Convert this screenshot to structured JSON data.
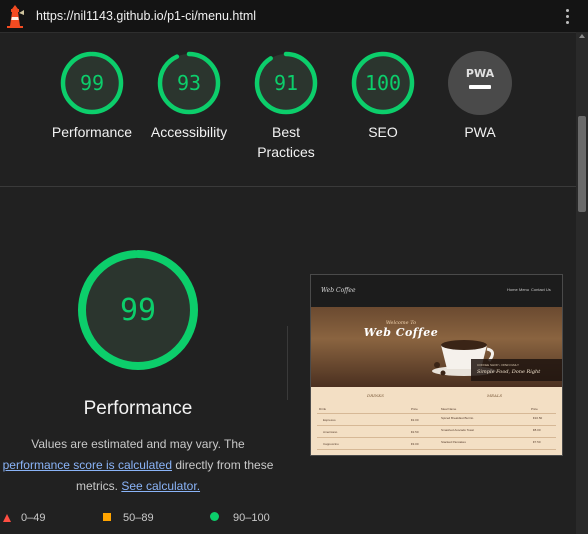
{
  "browser": {
    "url": "https://nil1143.github.io/p1-ci/menu.html"
  },
  "colors": {
    "pass": "#0cce6b",
    "average": "#ffa400",
    "fail": "#ff4e42",
    "pwa_gray": "#4a4a4a",
    "link": "#8ab4f8"
  },
  "gauges": [
    {
      "score": "99",
      "label": "Performance",
      "fraction": 0.99
    },
    {
      "score": "93",
      "label": "Accessibility",
      "fraction": 0.93
    },
    {
      "score": "91",
      "label": "Best Practices",
      "fraction": 0.91
    },
    {
      "score": "100",
      "label": "SEO",
      "fraction": 1.0
    },
    {
      "badge": "PWA",
      "label": "PWA"
    }
  ],
  "performance": {
    "score": "99",
    "fraction": 0.99,
    "title": "Performance",
    "desc_prefix": "Values are estimated and may vary. The ",
    "desc_link": "performance score is calculated",
    "desc_middle": " directly from these metrics. ",
    "desc_link2": "See calculator."
  },
  "legend": {
    "fail": "0–49",
    "average": "50–89",
    "pass": "90–100"
  },
  "screenshot": {
    "brand": "Web Coffee",
    "nav": [
      "Home",
      "Menu",
      "Contact Us"
    ],
    "hero_small": "Welcome To",
    "hero_title": "Web Coffee",
    "banner_small": "COFFEE SHOP • OPEN DAILY",
    "banner_text": "Simple Food, Done Right",
    "col_drinks": "DRINKS",
    "col_meals": "MEALS",
    "table_headers": [
      "Drink",
      "Price",
      "Meal Name",
      "Price"
    ],
    "rows": [
      [
        "Espresso",
        "€2.00",
        "Spiced Breakfast Burrito",
        "€10.50"
      ],
      [
        "Americano",
        "€2.50",
        "Smashed Avocado Toast",
        "€8.00"
      ],
      [
        "Cappuccino",
        "€3.00",
        "Stacked Pancakes",
        "€7.50"
      ]
    ]
  }
}
